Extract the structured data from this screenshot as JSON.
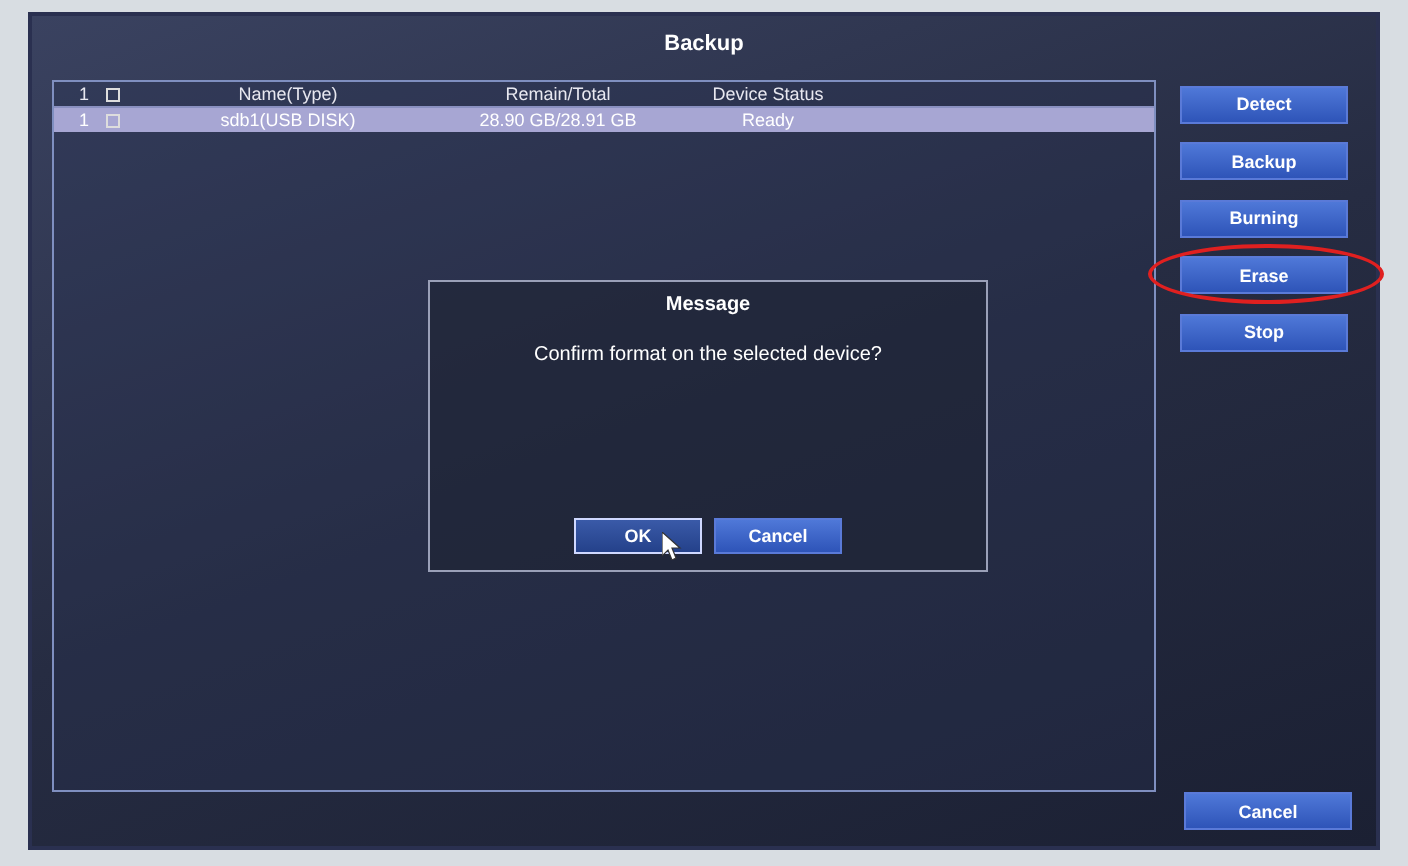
{
  "window": {
    "title": "Backup"
  },
  "table": {
    "columns": [
      "1",
      "Name(Type)",
      "Remain/Total",
      "Device Status"
    ],
    "header_checked": false,
    "rows": [
      {
        "index": "1",
        "checked": false,
        "selected": true,
        "name": "sdb1(USB DISK)",
        "remain_total": "28.90 GB/28.91 GB",
        "status": "Ready"
      }
    ]
  },
  "side_buttons": [
    {
      "label": "Detect",
      "highlighted": false
    },
    {
      "label": "Backup",
      "highlighted": false
    },
    {
      "label": "Burning",
      "highlighted": false
    },
    {
      "label": "Erase",
      "highlighted": true
    },
    {
      "label": "Stop",
      "highlighted": false
    }
  ],
  "dialog": {
    "title": "Message",
    "text": "Confirm format on the selected device?",
    "buttons": [
      {
        "label": "OK",
        "selected": true
      },
      {
        "label": "Cancel",
        "selected": false
      }
    ]
  },
  "cancel_button": "Cancel"
}
